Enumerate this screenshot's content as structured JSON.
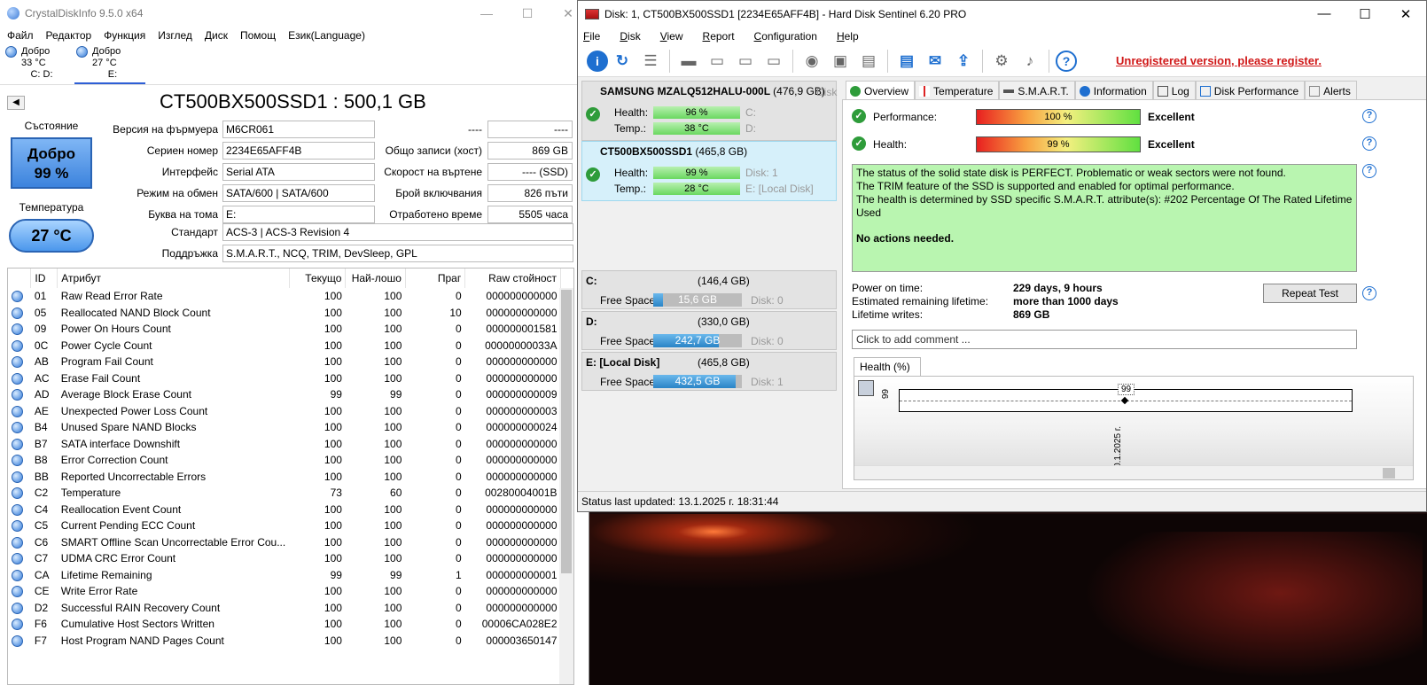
{
  "cdi": {
    "title": "CrystalDiskInfo 9.5.0 x64",
    "menu": [
      "Файл",
      "Редактор",
      "Функция",
      "Изглед",
      "Диск",
      "Помощ",
      "Език(Language)"
    ],
    "drives": [
      {
        "status": "Добро",
        "temp": "33 °C",
        "letters": "C: D:"
      },
      {
        "status": "Добро",
        "temp": "27 °C",
        "letters": "E:"
      }
    ],
    "model": "CT500BX500SSD1 : 500,1 GB",
    "status_label": "Състояние",
    "health_status": "Добро",
    "health_percent": "99 %",
    "temp_label": "Температура",
    "temperature": "27 °C",
    "firmware_label": "Версия на фърмуера",
    "firmware": "M6CR061",
    "serial_label": "Сериен номер",
    "serial": "2234E65AFF4B",
    "interface_label": "Интерфейс",
    "interface": "Serial ATA",
    "transfer_label": "Режим на обмен",
    "transfer": "SATA/600 | SATA/600",
    "volume_label": "Буква на тома",
    "volume": "E:",
    "standard_label": "Стандарт",
    "standard": "ACS-3 | ACS-3 Revision 4",
    "features_label": "Поддръжка",
    "features": "S.M.A.R.T., NCQ, TRIM, DevSleep, GPL",
    "blank_label": "----",
    "blank_value": "----",
    "host_writes_label": "Общо записи (хост)",
    "host_writes": "869 GB",
    "rotation_label": "Скорост на въртене",
    "rotation": "---- (SSD)",
    "power_count_label": "Брой включвания",
    "power_count": "826 пъти",
    "power_hours_label": "Отработено време",
    "power_hours": "5505 часа",
    "columns": [
      "ID",
      "Атрибут",
      "Текущо",
      "Най-лошо",
      "Праг",
      "Raw стойност"
    ],
    "attributes": [
      {
        "id": "01",
        "name": "Raw Read Error Rate",
        "cur": "100",
        "worst": "100",
        "thr": "0",
        "raw": "000000000000"
      },
      {
        "id": "05",
        "name": "Reallocated NAND Block Count",
        "cur": "100",
        "worst": "100",
        "thr": "10",
        "raw": "000000000000"
      },
      {
        "id": "09",
        "name": "Power On Hours Count",
        "cur": "100",
        "worst": "100",
        "thr": "0",
        "raw": "000000001581"
      },
      {
        "id": "0C",
        "name": "Power Cycle Count",
        "cur": "100",
        "worst": "100",
        "thr": "0",
        "raw": "00000000033A"
      },
      {
        "id": "AB",
        "name": "Program Fail Count",
        "cur": "100",
        "worst": "100",
        "thr": "0",
        "raw": "000000000000"
      },
      {
        "id": "AC",
        "name": "Erase Fail Count",
        "cur": "100",
        "worst": "100",
        "thr": "0",
        "raw": "000000000000"
      },
      {
        "id": "AD",
        "name": "Average Block Erase Count",
        "cur": "99",
        "worst": "99",
        "thr": "0",
        "raw": "000000000009"
      },
      {
        "id": "AE",
        "name": "Unexpected Power Loss Count",
        "cur": "100",
        "worst": "100",
        "thr": "0",
        "raw": "000000000003"
      },
      {
        "id": "B4",
        "name": "Unused Spare NAND Blocks",
        "cur": "100",
        "worst": "100",
        "thr": "0",
        "raw": "000000000024"
      },
      {
        "id": "B7",
        "name": "SATA interface Downshift",
        "cur": "100",
        "worst": "100",
        "thr": "0",
        "raw": "000000000000"
      },
      {
        "id": "B8",
        "name": "Error Correction Count",
        "cur": "100",
        "worst": "100",
        "thr": "0",
        "raw": "000000000000"
      },
      {
        "id": "BB",
        "name": "Reported Uncorrectable Errors",
        "cur": "100",
        "worst": "100",
        "thr": "0",
        "raw": "000000000000"
      },
      {
        "id": "C2",
        "name": "Temperature",
        "cur": "73",
        "worst": "60",
        "thr": "0",
        "raw": "00280004001B"
      },
      {
        "id": "C4",
        "name": "Reallocation Event Count",
        "cur": "100",
        "worst": "100",
        "thr": "0",
        "raw": "000000000000"
      },
      {
        "id": "C5",
        "name": "Current Pending ECC Count",
        "cur": "100",
        "worst": "100",
        "thr": "0",
        "raw": "000000000000"
      },
      {
        "id": "C6",
        "name": "SMART Offline Scan Uncorrectable Error Cou...",
        "cur": "100",
        "worst": "100",
        "thr": "0",
        "raw": "000000000000"
      },
      {
        "id": "C7",
        "name": "UDMA CRC Error Count",
        "cur": "100",
        "worst": "100",
        "thr": "0",
        "raw": "000000000000"
      },
      {
        "id": "CA",
        "name": "Lifetime Remaining",
        "cur": "99",
        "worst": "99",
        "thr": "1",
        "raw": "000000000001"
      },
      {
        "id": "CE",
        "name": "Write Error Rate",
        "cur": "100",
        "worst": "100",
        "thr": "0",
        "raw": "000000000000"
      },
      {
        "id": "D2",
        "name": "Successful RAIN Recovery Count",
        "cur": "100",
        "worst": "100",
        "thr": "0",
        "raw": "000000000000"
      },
      {
        "id": "F6",
        "name": "Cumulative Host Sectors Written",
        "cur": "100",
        "worst": "100",
        "thr": "0",
        "raw": "00006CA028E2"
      },
      {
        "id": "F7",
        "name": "Host Program NAND Pages Count",
        "cur": "100",
        "worst": "100",
        "thr": "0",
        "raw": "000003650147"
      }
    ]
  },
  "hds": {
    "title": "Disk: 1, CT500BX500SSD1 [2234E65AFF4B]  -  Hard Disk Sentinel 6.20 PRO",
    "menu": [
      "File",
      "Disk",
      "View",
      "Report",
      "Configuration",
      "Help"
    ],
    "unregistered": "Unregistered version, please register.",
    "disks": [
      {
        "name": "SAMSUNG MZALQ512HALU-000L",
        "size": "(476,9 GB)",
        "tag": "Disk",
        "health": "96 %",
        "temp": "38 °C",
        "health_hint": "C:",
        "temp_hint": "D:",
        "health_pct": 96
      },
      {
        "name": "CT500BX500SSD1",
        "size": "(465,8 GB)",
        "health": "99 %",
        "temp": "28 °C",
        "health_hint": "Disk: 1",
        "temp_hint": "E: [Local Disk]",
        "health_pct": 99
      }
    ],
    "health_label": "Health:",
    "temp_label": "Temp.:",
    "free_label": "Free Space",
    "volumes": [
      {
        "letter": "C:",
        "size": "(146,4 GB)",
        "free": "15,6 GB",
        "disk": "Disk: 0",
        "free_pct": 10.7
      },
      {
        "letter": "D:",
        "size": "(330,0 GB)",
        "free": "242,7 GB",
        "disk": "Disk: 0",
        "free_pct": 73.5
      },
      {
        "letter": "E: [Local Disk]",
        "size": "(465,8 GB)",
        "free": "432,5 GB",
        "disk": "Disk: 1",
        "free_pct": 92.8
      }
    ],
    "tabs": [
      "Overview",
      "Temperature",
      "S.M.A.R.T.",
      "Information",
      "Log",
      "Disk Performance",
      "Alerts"
    ],
    "performance_label": "Performance:",
    "performance_value": "100 %",
    "performance_rating": "Excellent",
    "health_label2": "Health:",
    "health_value": "99 %",
    "health_rating": "Excellent",
    "message_lines": [
      "The status of the solid state disk is PERFECT. Problematic or weak sectors were not found.",
      "The TRIM feature of the SSD is supported and enabled for optimal performance.",
      "The health is determined by SSD specific S.M.A.R.T. attribute(s):  #202 Percentage Of The Rated Lifetime Used"
    ],
    "message_action": "No actions needed.",
    "power_on_label": "Power on time:",
    "power_on": "229 days, 9 hours",
    "remaining_label": "Estimated remaining lifetime:",
    "remaining": "more than 1000 days",
    "writes_label": "Lifetime writes:",
    "writes": "869 GB",
    "repeat_test": "Repeat Test",
    "comment_placeholder": "Click to add comment ...",
    "chart_tab": "Health (%)",
    "status_bar": "Status last updated: 13.1.2025 г. 18:31:44"
  },
  "chart_data": {
    "type": "line",
    "title": "Health (%)",
    "x": [
      "0.1.2025 г."
    ],
    "series": [
      {
        "values": [
          99
        ]
      }
    ],
    "ytick": "99"
  }
}
